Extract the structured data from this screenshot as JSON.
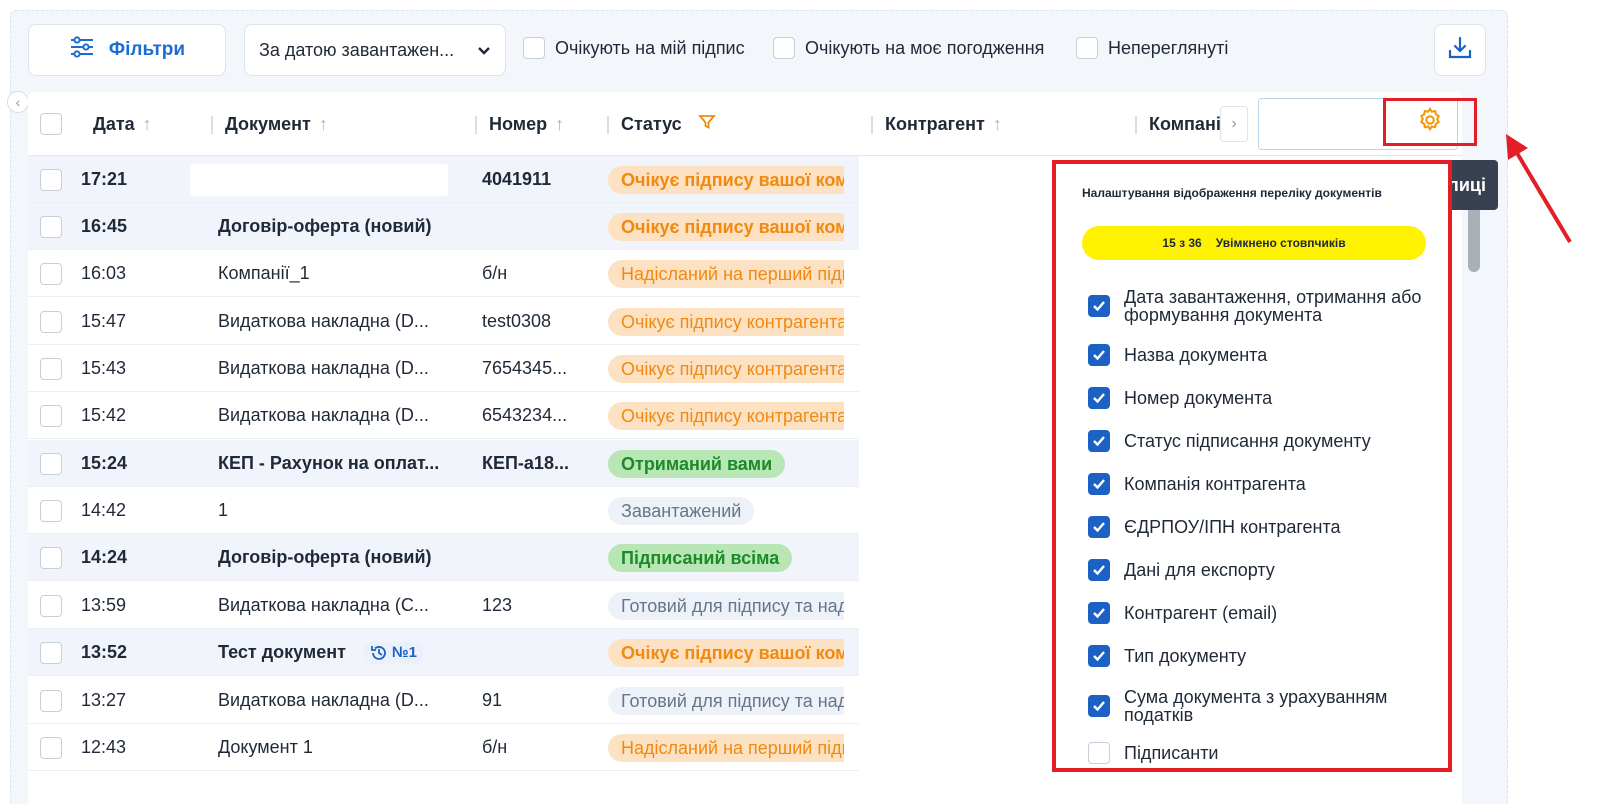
{
  "toolbar": {
    "filter_label": "Фільтри",
    "sort_value": "За датою завантажен...",
    "toggles": [
      "Очікують на мій підпис",
      "Очікують на моє погодження",
      "Непереглянуті"
    ]
  },
  "table": {
    "columns": [
      "Дата",
      "Документ",
      "Номер",
      "Статус",
      "Контрагент",
      "Компанія"
    ],
    "rows": [
      {
        "time": "17:21",
        "doc": "",
        "num": "4041911",
        "status": "Очікує підпису вашої компанії",
        "tone": "orange",
        "unread": true
      },
      {
        "time": "16:45",
        "doc": "Договір-оферта (новий)",
        "num": "",
        "status": "Очікує підпису вашої компанії",
        "tone": "orange",
        "unread": true
      },
      {
        "time": "16:03",
        "doc": "Компанії_1",
        "num": "б/н",
        "status": "Надісланий на перший підпис",
        "tone": "orange",
        "unread": false
      },
      {
        "time": "15:47",
        "doc": "Видаткова накладна (D...",
        "num": "test0308",
        "status": "Очікує підпису контрагента",
        "tone": "orange",
        "unread": false
      },
      {
        "time": "15:43",
        "doc": "Видаткова накладна (D...",
        "num": "7654345...",
        "status": "Очікує підпису контрагента",
        "tone": "orange",
        "unread": false
      },
      {
        "time": "15:42",
        "doc": "Видаткова накладна (D...",
        "num": "6543234...",
        "status": "Очікує підпису контрагента",
        "tone": "orange",
        "unread": false
      },
      {
        "time": "15:24",
        "doc": "КЕП - Рахунок на оплат...",
        "num": "КЕП-а18...",
        "status": "Отриманий вами",
        "tone": "green",
        "unread": true
      },
      {
        "time": "14:42",
        "doc": "1",
        "num": "",
        "status": "Завантажений",
        "tone": "gray",
        "unread": false
      },
      {
        "time": "14:24",
        "doc": "Договір-оферта (новий)",
        "num": "",
        "status": "Підписаний всіма",
        "tone": "green",
        "unread": true
      },
      {
        "time": "13:59",
        "doc": "Видаткова накладна (С...",
        "num": "123",
        "status": "Готовий для підпису та надсилання",
        "tone": "gray",
        "unread": false
      },
      {
        "time": "13:52",
        "doc": "Тест документ",
        "num": "",
        "status": "Очікує підпису вашої компанії",
        "tone": "orange",
        "unread": true,
        "version": "№1"
      },
      {
        "time": "13:27",
        "doc": "Видаткова накладна (D...",
        "num": "91",
        "status": "Готовий для підпису та надсилання",
        "tone": "gray",
        "unread": false
      },
      {
        "time": "12:43",
        "doc": "Документ 1",
        "num": "б/н",
        "status": "Надісланий на перший підпис",
        "tone": "orange",
        "unread": false
      }
    ]
  },
  "settings": {
    "tooltip": "лиці",
    "title": "Налаштування відображення переліку документів",
    "count": "15 з 36",
    "count_label": "Увімкнено стовпчиків",
    "items": [
      {
        "label": "Дата завантаження, отримання або формування документа",
        "checked": true
      },
      {
        "label": "Назва документа",
        "checked": true
      },
      {
        "label": "Номер документа",
        "checked": true
      },
      {
        "label": "Статус підписання документу",
        "checked": true
      },
      {
        "label": "Компанія контрагента",
        "checked": true
      },
      {
        "label": "ЄДРПОУ/ІПН контрагента",
        "checked": true
      },
      {
        "label": "Дані для експорту",
        "checked": true
      },
      {
        "label": "Контрагент (email)",
        "checked": true
      },
      {
        "label": "Тип документу",
        "checked": true
      },
      {
        "label": "Сума документа з урахуванням податків",
        "checked": true
      },
      {
        "label": "Підписанти",
        "checked": false
      }
    ]
  },
  "colors": {
    "accent": "#1c62c4",
    "highlight": "#e41e26",
    "badge": "#fff200",
    "warning": "#f08a10",
    "success": "#1d8a2a"
  }
}
